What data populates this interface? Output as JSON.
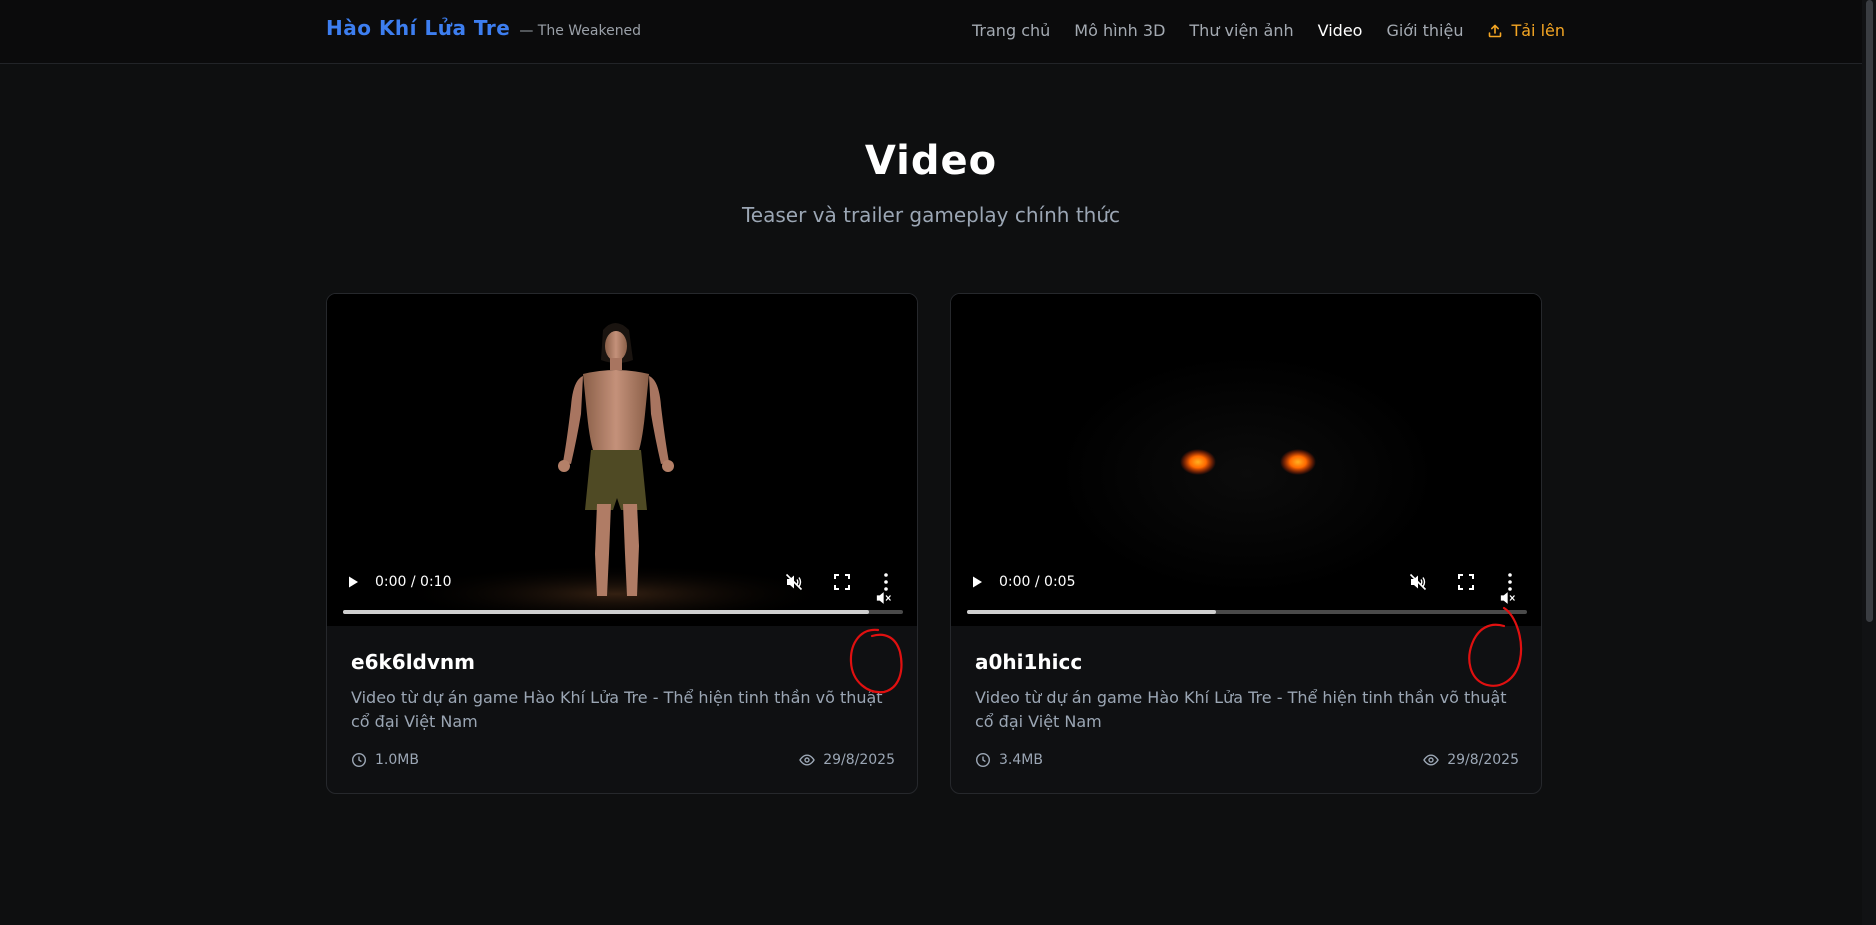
{
  "header": {
    "brand_title": "Hào Khí Lửa Tre",
    "brand_subtitle": "— The Weakened",
    "nav": [
      {
        "label": "Trang chủ"
      },
      {
        "label": "Mô hình 3D"
      },
      {
        "label": "Thư viện ảnh"
      },
      {
        "label": "Video",
        "active": true
      },
      {
        "label": "Giới thiệu"
      }
    ],
    "upload_label": "Tải lên",
    "colors": {
      "brand": "#3d7ef0",
      "upload": "#f5a623"
    }
  },
  "hero": {
    "title": "Video",
    "subtitle": "Teaser và trailer gameplay chính thức"
  },
  "videos": [
    {
      "name": "e6k6ldvnm",
      "description": "Video từ dự án game Hào Khí Lửa Tre - Thể hiện tinh thần võ thuật cổ đại Việt Nam",
      "time": "0:00 / 0:10",
      "progress": 0.94,
      "size": "1.0MB",
      "date": "29/8/2025",
      "thumbnail": "character-standing"
    },
    {
      "name": "a0hi1hicc",
      "description": "Video từ dự án game Hào Khí Lửa Tre - Thể hiện tinh thần võ thuật cổ đại Việt Nam",
      "time": "0:00 / 0:05",
      "progress": 0.445,
      "size": "3.4MB",
      "date": "29/8/2025",
      "thumbnail": "glowing-eyes"
    }
  ],
  "icons": {
    "upload": "upload-icon",
    "play": "play-icon",
    "mute": "volume-muted-icon",
    "fullscreen": "fullscreen-icon",
    "more": "more-vertical-icon",
    "clock": "clock-icon",
    "eye": "eye-icon"
  },
  "annotation_color": "#e01010"
}
